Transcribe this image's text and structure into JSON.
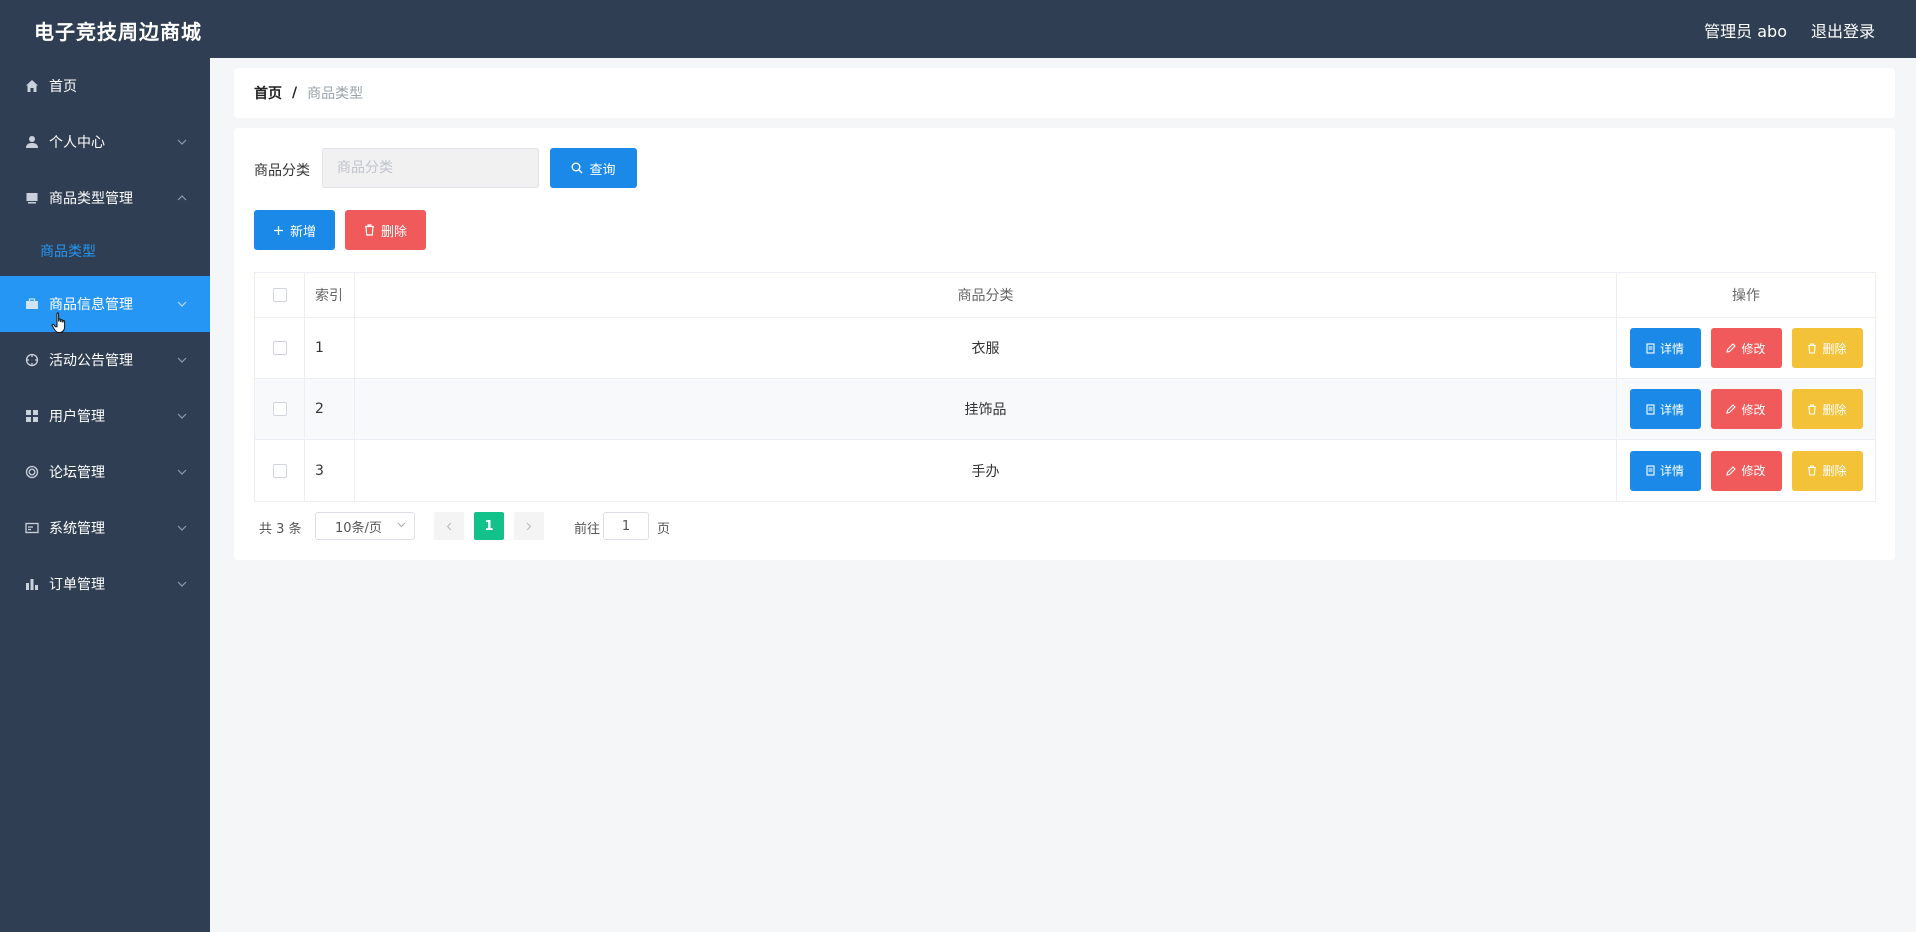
{
  "header": {
    "brand": "电子竞技周边商城",
    "user_label": "管理员 abo",
    "logout_label": "退出登录"
  },
  "sidebar": {
    "items": [
      {
        "label": "首页",
        "icon": "home-icon"
      },
      {
        "label": "个人中心",
        "icon": "user-icon"
      },
      {
        "label": "商品类型管理",
        "icon": "box-icon"
      },
      {
        "label": "商品信息管理",
        "icon": "briefcase-icon"
      },
      {
        "label": "活动公告管理",
        "icon": "compass-icon"
      },
      {
        "label": "用户管理",
        "icon": "grid-icon"
      },
      {
        "label": "论坛管理",
        "icon": "circle-icon"
      },
      {
        "label": "系统管理",
        "icon": "card-icon"
      },
      {
        "label": "订单管理",
        "icon": "bar-chart-icon"
      }
    ],
    "sub_item": "商品类型",
    "active_color": "#2596f3"
  },
  "breadcrumb": {
    "home": "首页",
    "separator": "/",
    "current": "商品类型"
  },
  "search": {
    "label": "商品分类",
    "placeholder": "商品分类",
    "query_label": "查询"
  },
  "toolbar": {
    "add_label": "新增",
    "delete_label": "删除"
  },
  "table": {
    "columns": [
      "索引",
      "商品分类",
      "操作"
    ],
    "rows": [
      {
        "index": "1",
        "category": "衣服"
      },
      {
        "index": "2",
        "category": "挂饰品"
      },
      {
        "index": "3",
        "category": "手办"
      }
    ],
    "actions": {
      "detail": "详情",
      "edit": "修改",
      "delete": "删除"
    }
  },
  "pagination": {
    "total": "共 3 条",
    "page_size": "10条/页",
    "current_page": "1",
    "goto_label": "前往",
    "jump_value": "1",
    "page_suffix": "页"
  },
  "colors": {
    "topbar": "#2f3e52",
    "primary": "#1a89e8",
    "danger": "#f05a5a",
    "warning": "#f4c239",
    "success": "#13c28a"
  }
}
